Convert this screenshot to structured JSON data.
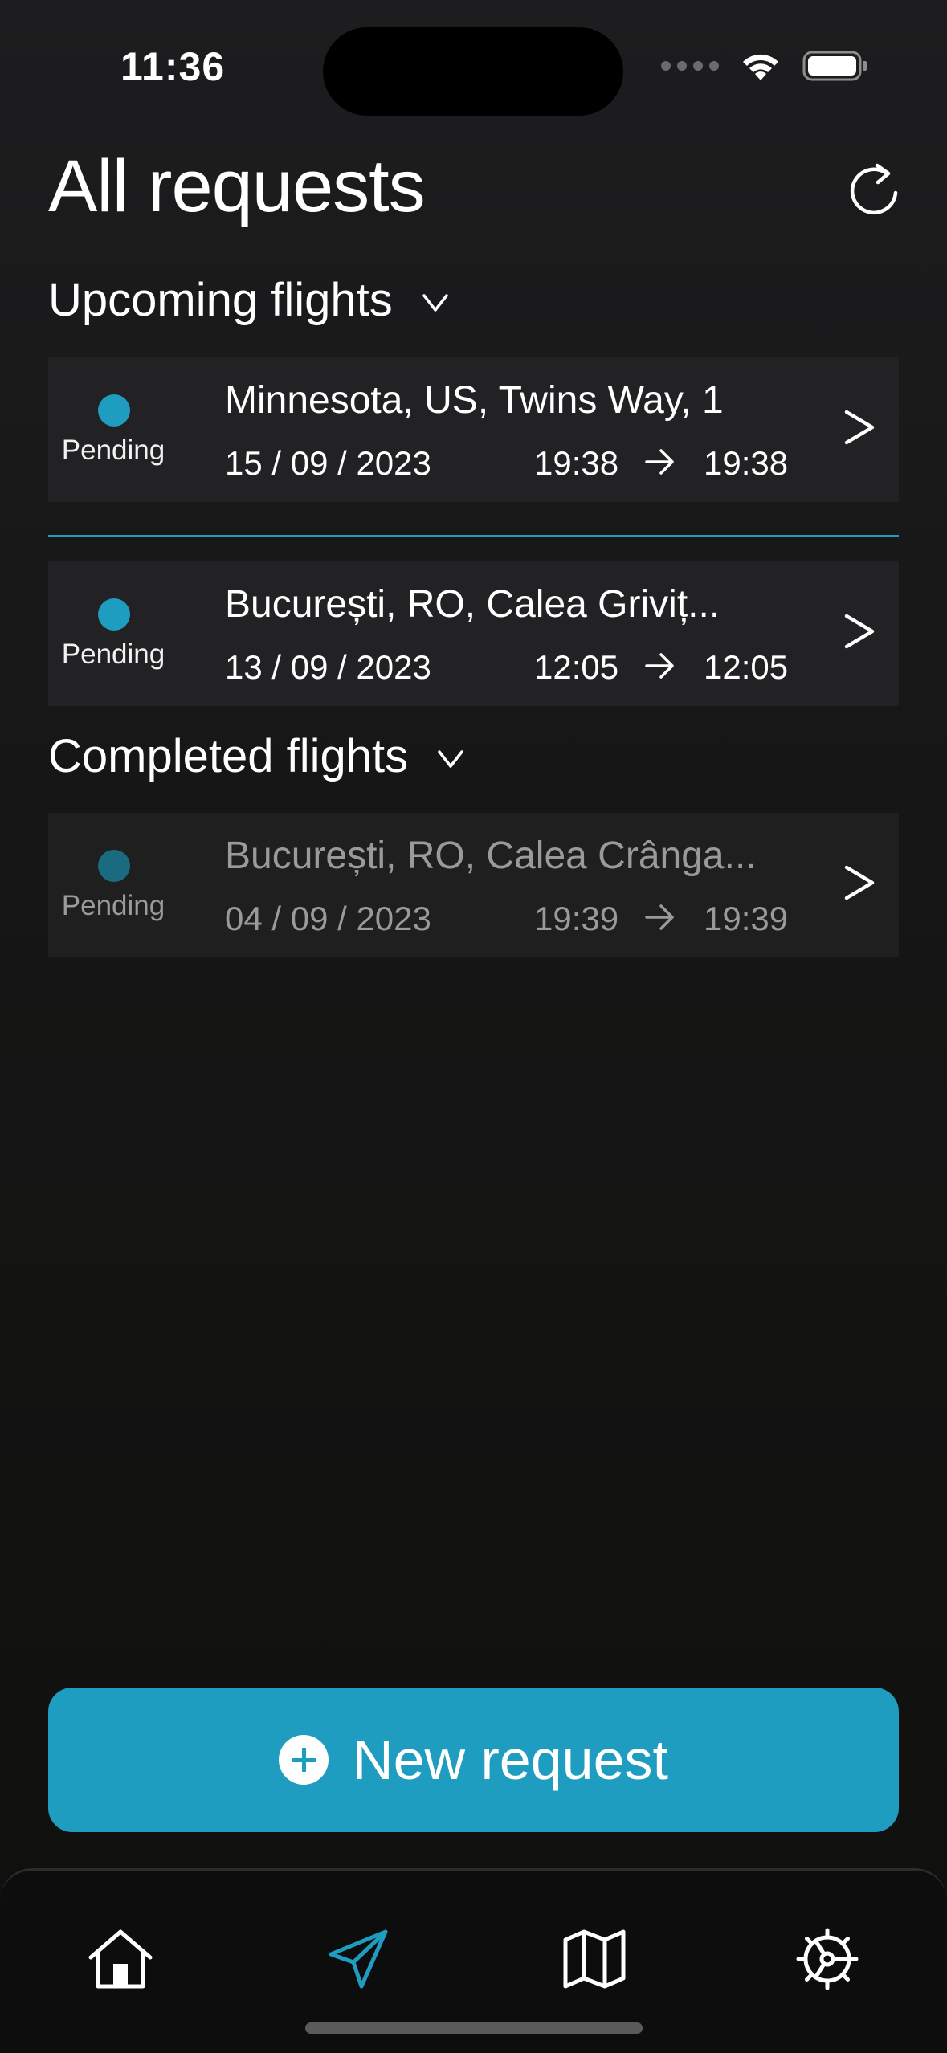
{
  "status_bar": {
    "time": "11:36"
  },
  "header": {
    "title": "All requests"
  },
  "upcoming": {
    "title": "Upcoming flights",
    "items": [
      {
        "status": "Pending",
        "address": "Minnesota, US, Twins Way, 1",
        "date": "15 / 09 / 2023",
        "time_start": "19:38",
        "time_end": "19:38"
      },
      {
        "status": "Pending",
        "address": "București, RO, Calea Griviț...",
        "date": "13 / 09 / 2023",
        "time_start": "12:05",
        "time_end": "12:05"
      }
    ]
  },
  "completed": {
    "title": "Completed flights",
    "items": [
      {
        "status": "Pending",
        "address": "București, RO, Calea Crânga...",
        "date": "04 / 09 / 2023",
        "time_start": "19:39",
        "time_end": "19:39"
      }
    ]
  },
  "new_request": {
    "label": "New request"
  },
  "tab_bar": {
    "tabs": [
      {
        "icon": "home-icon",
        "active": false
      },
      {
        "icon": "paper-plane-icon",
        "active": true
      },
      {
        "icon": "map-icon",
        "active": false
      },
      {
        "icon": "settings-wheel-icon",
        "active": false
      }
    ]
  },
  "colors": {
    "accent": "#1e9dc0",
    "background": "#161616",
    "card": "#222224"
  }
}
